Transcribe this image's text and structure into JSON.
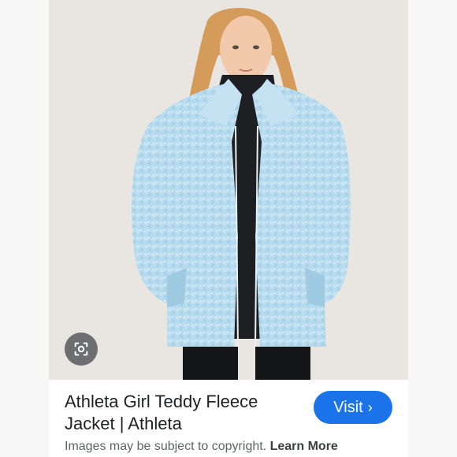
{
  "product": {
    "title_line1": "Athleta Girl Teddy Fleece",
    "title_line2": "Jacket | Athleta"
  },
  "visit_button": {
    "label": "Visit",
    "chevron": "›",
    "color": "#1a73e8"
  },
  "footer": {
    "copyright_text": "Images may be subject to copyright.",
    "learn_more": "Learn More"
  },
  "icons": {
    "lens": "google-lens-icon"
  }
}
